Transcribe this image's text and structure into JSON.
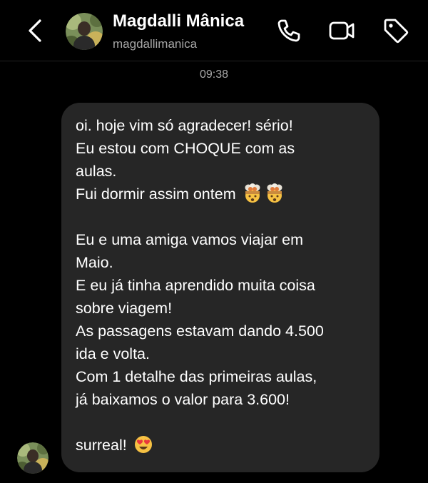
{
  "header": {
    "name": "Magdalli Mânica",
    "handle": "magdallimanica",
    "icons": [
      "back-chevron-icon",
      "phone-icon",
      "video-camera-icon",
      "tag-icon"
    ]
  },
  "conversation": {
    "timestamp": "09:38",
    "message_lines": [
      {
        "text": "oi. hoje vim só agradecer! sério!"
      },
      {
        "text": "Eu estou com CHOQUE com as"
      },
      {
        "text": "aulas."
      },
      {
        "text": "Fui dormir assim ontem ",
        "emojis": [
          "exploding-head-emoji",
          "exploding-head-emoji"
        ]
      },
      {
        "text": ""
      },
      {
        "text": "Eu e uma amiga vamos viajar em"
      },
      {
        "text": "Maio."
      },
      {
        "text": "E eu já tinha aprendido muita coisa"
      },
      {
        "text": "sobre viagem!"
      },
      {
        "text": "As passagens estavam dando 4.500"
      },
      {
        "text": "ida e volta."
      },
      {
        "text": "Com 1 detalhe das primeiras aulas,"
      },
      {
        "text": "já baixamos o valor para 3.600!"
      },
      {
        "text": ""
      },
      {
        "text": "surreal! ",
        "emojis": [
          "heart-eyes-emoji"
        ]
      }
    ]
  },
  "colors": {
    "background": "#000000",
    "bubble": "#262626",
    "secondary_text": "#a8a8a8"
  }
}
